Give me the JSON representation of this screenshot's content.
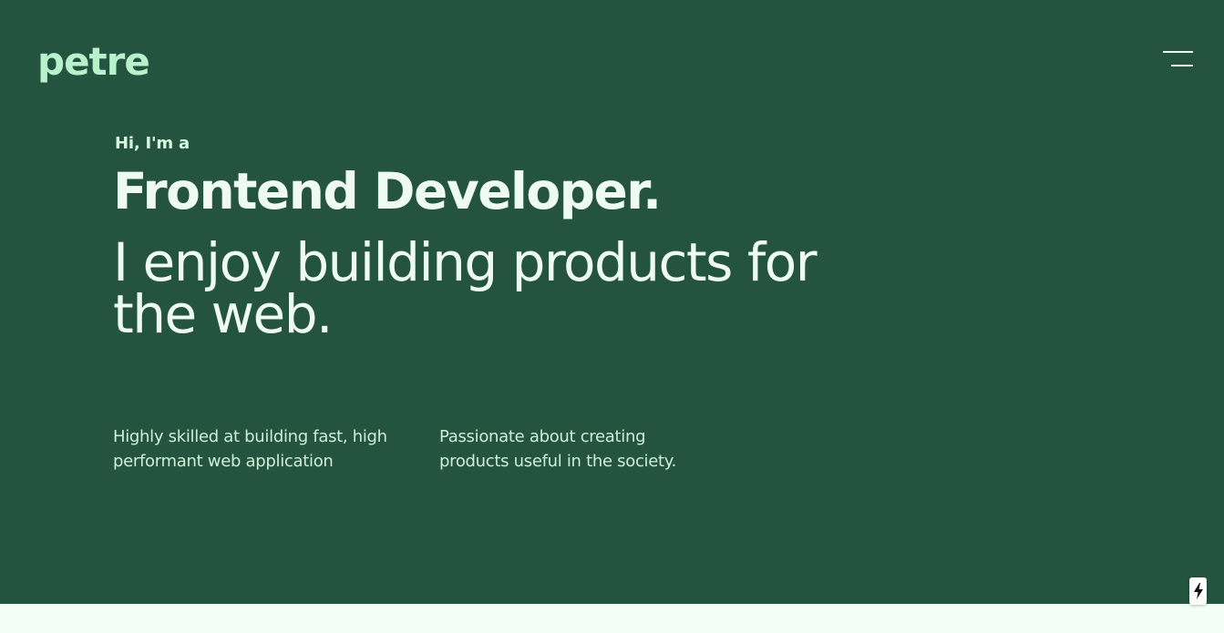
{
  "colors": {
    "hero_background": "#24533f",
    "page_background": "#f3fff6",
    "logo": "#b9f1cd",
    "heading_text": "#eefbf2",
    "body_text": "#cdeed8"
  },
  "header": {
    "logo_text": "petre",
    "menu_icon": "hamburger-menu-icon"
  },
  "hero": {
    "intro": "Hi, I'm a",
    "role": "Frontend Developer.",
    "tagline": "I enjoy building products for the web."
  },
  "features": [
    {
      "text": "Highly skilled at building fast, high performant web application"
    },
    {
      "text": "Passionate about creating products useful in the society."
    }
  ],
  "corner_badge": {
    "icon": "lightning-bolt-icon"
  }
}
